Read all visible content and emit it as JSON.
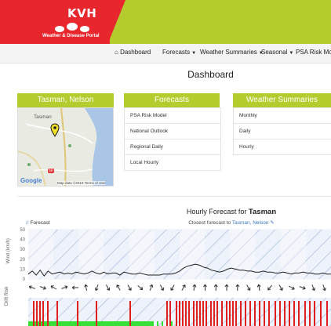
{
  "header": {
    "logo_text": "KVH",
    "logo_subtitle": "Weather & Disease Portal",
    "colors": {
      "red": "#e8262e",
      "green": "#b5cc2e"
    }
  },
  "nav": {
    "items": [
      {
        "icon": "home-icon",
        "label": "Dashboard",
        "dropdown": false
      },
      {
        "label": "Forecasts",
        "dropdown": true
      },
      {
        "label": "Weather Summaries",
        "dropdown": true
      },
      {
        "label": "Seasonal",
        "dropdown": true
      },
      {
        "label": "PSA Risk Mod",
        "dropdown": false
      }
    ]
  },
  "page": {
    "title": "Dashboard"
  },
  "cards": {
    "location": {
      "title": "Tasman, Nelson",
      "map_label": "Tasman",
      "map_google": "Google",
      "map_attribution": "Map data ©2019   Terms of Use",
      "road_badge": "60"
    },
    "forecasts": {
      "title": "Forecasts",
      "items": [
        "PSA Risk Model",
        "National Outlook",
        "Regional Daily",
        "Local Hourly"
      ]
    },
    "summaries": {
      "title": "Weather Summaries",
      "items": [
        "Monthly",
        "Daily",
        "Hourly"
      ]
    }
  },
  "forecast": {
    "title_prefix": "Hourly Forecast for",
    "title_location": "Tasman",
    "subtitle_prefix": "Closest forecast to",
    "subtitle_link": "Tasman, Nelson",
    "legend_label": "Forecast",
    "drift_ylabel": "Drift Risk"
  },
  "chart_data": {
    "type": "line",
    "ylabel": "Wind (km/h)",
    "ylim": [
      0,
      50
    ],
    "yticks": [
      0,
      10,
      20,
      30,
      40,
      50
    ],
    "grid": true,
    "series": [
      {
        "values": [
          5,
          8,
          4,
          9,
          3,
          8,
          5,
          6,
          7,
          5,
          6,
          5,
          7,
          6,
          5,
          6,
          8,
          6,
          5,
          7,
          5,
          6,
          6,
          4,
          7,
          6,
          5,
          5,
          6,
          5,
          4,
          4,
          4,
          4,
          5,
          5,
          5,
          6,
          8,
          11,
          13,
          14,
          15,
          14,
          12,
          11,
          9,
          8,
          7,
          8,
          10,
          11,
          10,
          9,
          9,
          8,
          8,
          7,
          7,
          8,
          7,
          7,
          6,
          6,
          7,
          6,
          5,
          6,
          6,
          7,
          6,
          6,
          5,
          5,
          6,
          5,
          5
        ]
      }
    ]
  }
}
